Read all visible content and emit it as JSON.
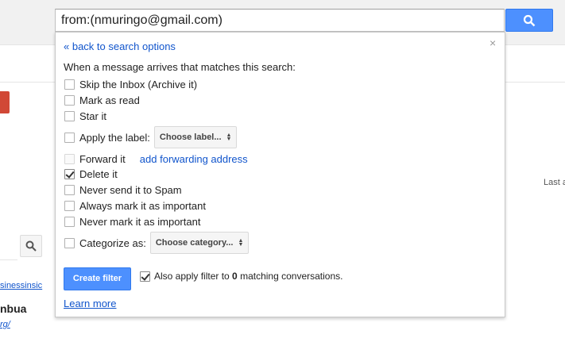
{
  "search": {
    "query": "from:(nmuringo@gmail.com)"
  },
  "background": {
    "link_text": "sinessinsic",
    "bold_text": "nbua",
    "link2_text": "rg/",
    "last_text": "Last a"
  },
  "filter": {
    "back_link": "« back to search options",
    "close": "×",
    "heading": "When a message arrives that matches this search:",
    "options": {
      "skip_inbox": "Skip the Inbox (Archive it)",
      "mark_read": "Mark as read",
      "star": "Star it",
      "apply_label": "Apply the label:",
      "label_select": "Choose label...",
      "forward": "Forward it",
      "forward_link": "add forwarding address",
      "delete": "Delete it",
      "never_spam": "Never send it to Spam",
      "always_important": "Always mark it as important",
      "never_important": "Never mark it as important",
      "categorize": "Categorize as:",
      "category_select": "Choose category..."
    },
    "create_button": "Create filter",
    "also_apply_prefix": "Also apply filter to ",
    "also_apply_count": "0",
    "also_apply_suffix": " matching conversations.",
    "learn_more": "Learn more"
  },
  "colors": {
    "accent_blue": "#4d90fe",
    "link_blue": "#1155cc",
    "compose_red": "#d14836"
  }
}
